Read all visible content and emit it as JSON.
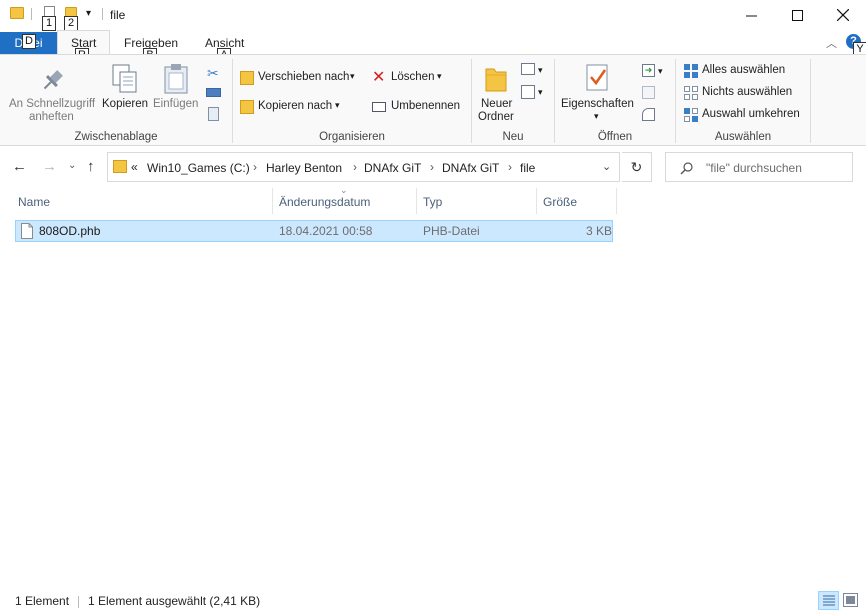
{
  "window": {
    "title": "file",
    "controls": {
      "minimize": "—",
      "maximize": "☐",
      "close": "✕"
    }
  },
  "quick_access": {
    "keytips": [
      "1",
      "2"
    ]
  },
  "ribbon_tabs": {
    "file": "Datei",
    "items": [
      {
        "label": "Start",
        "keytip": "R"
      },
      {
        "label": "Freigeben",
        "keytip": "B"
      },
      {
        "label": "Ansicht",
        "keytip": "A"
      }
    ],
    "file_keytip": "D",
    "help_keytip": "Y",
    "collapse_icon": "chevron-up-icon"
  },
  "ribbon": {
    "zwischenablage": {
      "label": "Zwischenablage",
      "pin": [
        "An Schnellzugriff",
        "anheften"
      ],
      "copy": "Kopieren",
      "paste": "Einfügen"
    },
    "organisieren": {
      "label": "Organisieren",
      "move_to": "Verschieben nach",
      "copy_to": "Kopieren nach",
      "delete": "Löschen",
      "rename": "Umbenennen"
    },
    "neu": {
      "label": "Neu",
      "new_folder": [
        "Neuer",
        "Ordner"
      ]
    },
    "oeffnen": {
      "label": "Öffnen",
      "properties": "Eigenschaften"
    },
    "auswaehlen": {
      "label": "Auswählen",
      "select_all": "Alles auswählen",
      "select_none": "Nichts auswählen",
      "invert": "Auswahl umkehren"
    }
  },
  "address": {
    "overflow": "«",
    "crumbs": [
      "Win10_Games (C:)",
      "Harley Benton",
      "DNAfx GiT",
      "DNAfx GiT",
      "file"
    ],
    "search_placeholder": "\"file\" durchsuchen"
  },
  "columns": [
    "Name",
    "Änderungsdatum",
    "Typ",
    "Größe"
  ],
  "files": [
    {
      "name": "808OD.phb",
      "modified": "18.04.2021 00:58",
      "type": "PHB-Datei",
      "size": "3 KB"
    }
  ],
  "status": {
    "count": "1 Element",
    "selected": "1 Element ausgewählt (2,41 KB)"
  },
  "colors": {
    "accent": "#1f6fc4",
    "selection_bg": "#cce8ff",
    "selection_border": "#99d1ff",
    "folder": "#f4c542"
  }
}
